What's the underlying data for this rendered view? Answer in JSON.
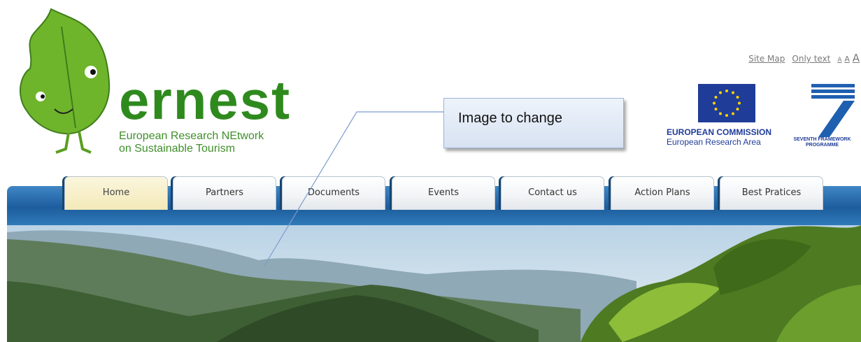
{
  "logo": {
    "word": "ernest",
    "subtitle_line1": "European Research NEtwork",
    "subtitle_line2": "on Sustainable Tourism"
  },
  "utility": {
    "site_map": "Site Map",
    "only_text": "Only text",
    "font_small": "A",
    "font_medium": "A",
    "font_large": "A"
  },
  "partners": {
    "ec_line1": "EUROPEAN COMMISSION",
    "ec_line2": "European Research Area",
    "fp7_line1": "SEVENTH FRAMEWORK",
    "fp7_line2": "PROGRAMME"
  },
  "callout": {
    "text": "Image to change"
  },
  "nav": {
    "tabs": [
      {
        "label": "Home",
        "active": true
      },
      {
        "label": "Partners"
      },
      {
        "label": "Documents"
      },
      {
        "label": "Events"
      },
      {
        "label": "Contact us"
      },
      {
        "label": "Action Plans"
      },
      {
        "label": "Best Pratices"
      }
    ]
  },
  "colors": {
    "brand_green": "#2f8a1e",
    "nav_blue": "#1d5d9e",
    "eu_blue": "#1f3c98",
    "active_tab": "#f3e9b8"
  }
}
